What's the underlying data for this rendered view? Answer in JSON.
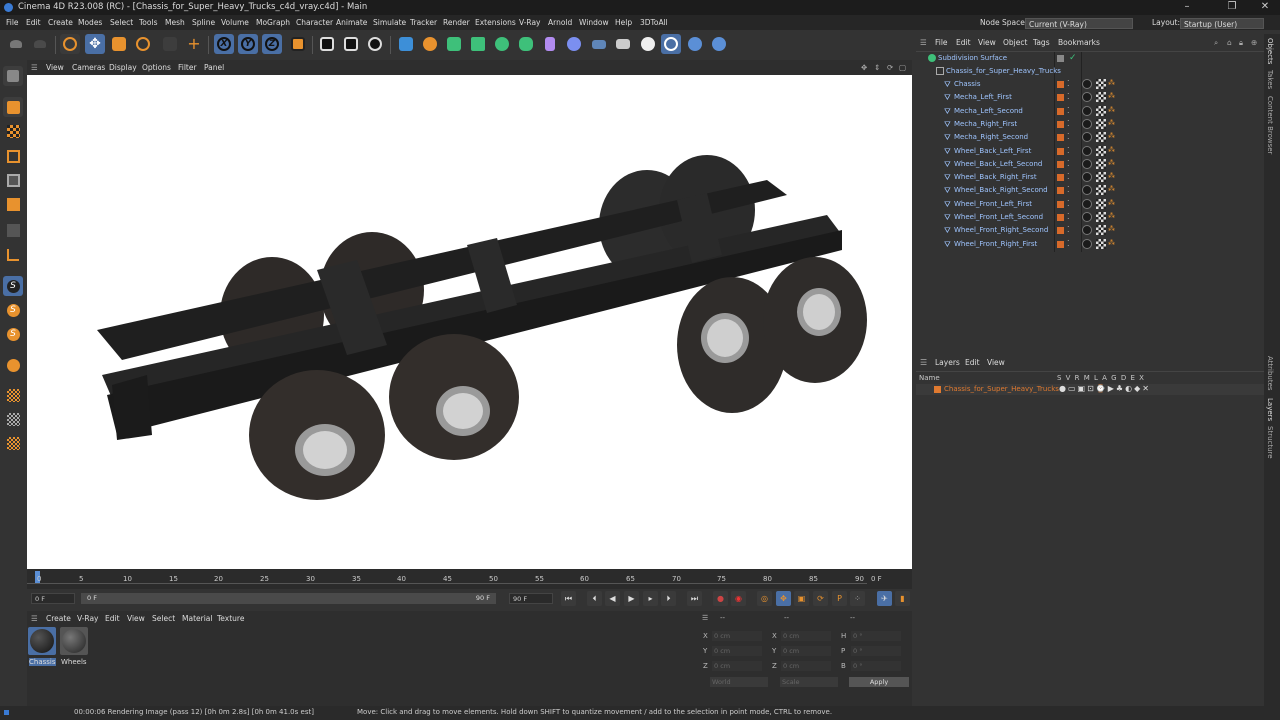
{
  "window": {
    "title": "Cinema 4D R23.008 (RC) - [Chassis_for_Super_Heavy_Trucks_c4d_vray.c4d] - Main"
  },
  "menubar": {
    "items": [
      "File",
      "Edit",
      "Create",
      "Modes",
      "Select",
      "Tools",
      "Mesh",
      "Spline",
      "Volume",
      "MoGraph",
      "Character",
      "Animate",
      "Simulate",
      "Tracker",
      "Render",
      "Extensions",
      "V-Ray",
      "Arnold",
      "Window",
      "Help",
      "3DToAll"
    ],
    "node_space_label": "Node Space:",
    "node_space_value": "Current (V-Ray)",
    "layout_label": "Layout:",
    "layout_value": "Startup (User)"
  },
  "viewport": {
    "menu": [
      "View",
      "Cameras",
      "Display",
      "Options",
      "Filter",
      "Panel"
    ]
  },
  "timeline": {
    "ticks": [
      "0",
      "5",
      "10",
      "15",
      "20",
      "25",
      "30",
      "35",
      "40",
      "45",
      "50",
      "55",
      "60",
      "65",
      "70",
      "75",
      "80",
      "85",
      "90"
    ],
    "current_frame": "0 F"
  },
  "playback": {
    "start": "0 F",
    "range_start": "0 F",
    "range_end": "90 F",
    "end": "90 F"
  },
  "materials": {
    "menu": [
      "Create",
      "V-Ray",
      "Edit",
      "View",
      "Select",
      "Material",
      "Texture"
    ],
    "items": [
      {
        "name": "Chassis",
        "color": "#1e1e1e"
      },
      {
        "name": "Wheels",
        "color": "#3a3a3a"
      }
    ]
  },
  "coords": {
    "headers": [
      "--",
      "--",
      "--"
    ],
    "rows": [
      {
        "a": "X",
        "av": "0 cm",
        "b": "X",
        "bv": "0 cm",
        "c": "H",
        "cv": "0 °"
      },
      {
        "a": "Y",
        "av": "0 cm",
        "b": "Y",
        "bv": "0 cm",
        "c": "P",
        "cv": "0 °"
      },
      {
        "a": "Z",
        "av": "0 cm",
        "b": "Z",
        "bv": "0 cm",
        "c": "B",
        "cv": "0 °"
      }
    ],
    "world": "World",
    "scale": "Scale",
    "apply": "Apply"
  },
  "objects": {
    "menu": [
      "File",
      "Edit",
      "View",
      "Object",
      "Tags",
      "Bookmarks"
    ],
    "root": "Subdivision Surface",
    "group": "Chassis_for_Super_Heavy_Trucks",
    "items": [
      "Chassis",
      "Mecha_Left_First",
      "Mecha_Left_Second",
      "Mecha_Right_First",
      "Mecha_Right_Second",
      "Wheel_Back_Left_First",
      "Wheel_Back_Left_Second",
      "Wheel_Back_Right_First",
      "Wheel_Back_Right_Second",
      "Wheel_Front_Left_First",
      "Wheel_Front_Left_Second",
      "Wheel_Front_Right_Second",
      "Wheel_Front_Right_First"
    ]
  },
  "layers": {
    "menu": [
      "Layers",
      "Edit",
      "View"
    ],
    "name_header": "Name",
    "flags": "S V R M L A G D E X",
    "layer_name": "Chassis_for_Super_Heavy_Trucks"
  },
  "sidetabs": [
    "Objects",
    "Takes",
    "Content Browser",
    "Attributes",
    "Layers",
    "Structure"
  ],
  "status": {
    "left": "00:00:06 Rendering Image (pass 12) [0h  0m  2.8s] [0h  0m 41.0s est]",
    "right": "Move: Click and drag to move elements. Hold down SHIFT to quantize movement / add to the selection in point mode, CTRL to remove."
  },
  "colors": {
    "accent": "#d86a2a",
    "blue": "#3a7bd5",
    "obj_text": "#9fc5ff",
    "layer_text": "#e07a30"
  }
}
